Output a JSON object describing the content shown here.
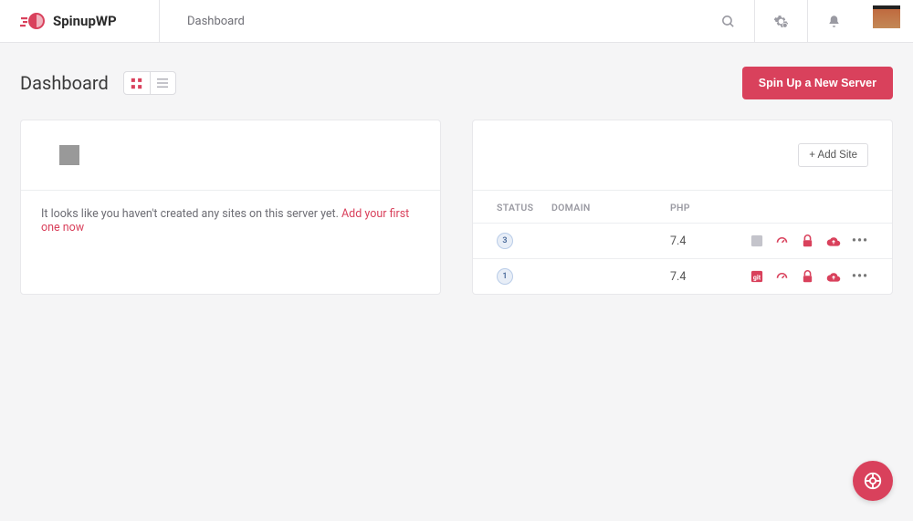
{
  "brand": "SpinupWP",
  "breadcrumb": "Dashboard",
  "page_title": "Dashboard",
  "primary_button": "Spin Up a New Server",
  "empty_card": {
    "message_prefix": "It looks like you haven't created any sites on this server yet. ",
    "link_text": "Add your first one now"
  },
  "sites_card": {
    "add_site_label": "+ Add Site",
    "columns": {
      "status": "STATUS",
      "domain": "DOMAIN",
      "php": "PHP"
    },
    "rows": [
      {
        "status": "3",
        "domain": "",
        "php": "7.4",
        "git_muted": true
      },
      {
        "status": "1",
        "domain": "",
        "php": "7.4",
        "git_muted": false
      }
    ]
  }
}
